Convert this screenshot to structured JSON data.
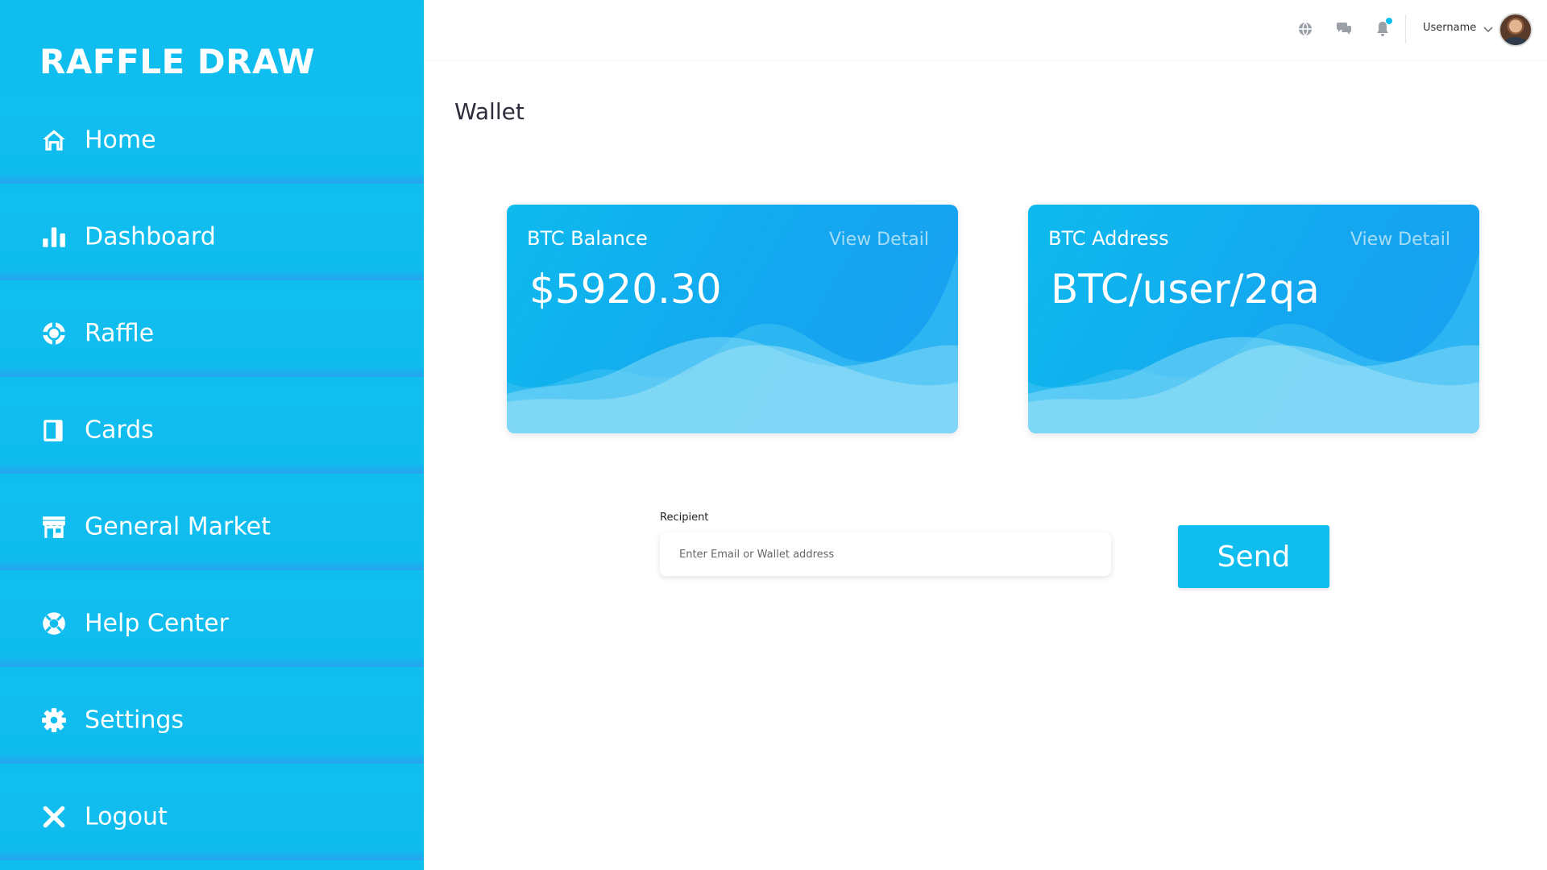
{
  "brand": {
    "title": "RAFFLE DRAW"
  },
  "sidebar": {
    "items": [
      {
        "label": "Home",
        "icon": "home-icon"
      },
      {
        "label": "Dashboard",
        "icon": "bar-chart-icon"
      },
      {
        "label": "Raffle",
        "icon": "raffle-chip-icon"
      },
      {
        "label": "Cards",
        "icon": "cards-icon"
      },
      {
        "label": "General Market",
        "icon": "store-icon"
      },
      {
        "label": "Help Center",
        "icon": "lifebuoy-icon"
      },
      {
        "label": "Settings",
        "icon": "gear-icon"
      },
      {
        "label": "Logout",
        "icon": "close-icon"
      }
    ]
  },
  "header": {
    "icons": [
      "globe-icon",
      "chat-icon",
      "bell-icon"
    ],
    "username": "Username"
  },
  "main": {
    "title": "Wallet",
    "cards": [
      {
        "title": "BTC Balance",
        "value": "$5920.30",
        "link": "View Detail"
      },
      {
        "title": "BTC Address",
        "value": "BTC/user/2qa",
        "link": "View Detail"
      }
    ],
    "recipient": {
      "label": "Recipient",
      "placeholder": "Enter Email or Wallet address",
      "value": ""
    },
    "send_label": "Send"
  },
  "colors": {
    "accent": "#0fbdef",
    "sidebar_bg": "#0fbdef",
    "card_gradient_start": "#0ebaed",
    "card_gradient_end": "#1aa0f2",
    "view_detail_text": "#a7dcf7",
    "notification_dot": "#0fbdef"
  }
}
